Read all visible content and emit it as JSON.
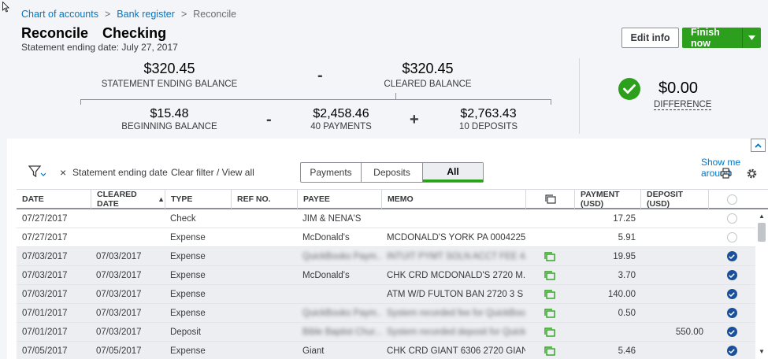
{
  "breadcrumb": {
    "item1": "Chart of accounts",
    "item2": "Bank register",
    "current": "Reconcile",
    "sep": ">"
  },
  "header": {
    "title": "Reconcile",
    "account": "Checking",
    "subtitle": "Statement ending date: July 27, 2017"
  },
  "buttons": {
    "edit_info": "Edit info",
    "finish_now": "Finish now"
  },
  "summary": {
    "statement_ending_balance": "$320.45",
    "statement_ending_balance_label": "STATEMENT ENDING BALANCE",
    "cleared_balance": "$320.45",
    "cleared_balance_label": "CLEARED BALANCE",
    "beginning_balance": "$15.48",
    "beginning_balance_label": "BEGINNING BALANCE",
    "payments_total": "$2,458.46",
    "payments_label": "40 PAYMENTS",
    "deposits_total": "$2,763.43",
    "deposits_label": "10 DEPOSITS",
    "difference": "$0.00",
    "difference_label": "DIFFERENCE",
    "op_minus": "-",
    "op_plus": "+"
  },
  "filter": {
    "close": "×",
    "statement_filter": "Statement ending date",
    "clear_filter": "Clear filter / View all"
  },
  "tabs": [
    {
      "label": "Payments"
    },
    {
      "label": "Deposits"
    },
    {
      "label": "All"
    }
  ],
  "links": {
    "show_me_around": "Show me around"
  },
  "table": {
    "columns": {
      "date": "DATE",
      "cleared_date": "CLEARED DATE",
      "sort_arrow": "▲",
      "type": "TYPE",
      "ref_no": "REF NO.",
      "payee": "PAYEE",
      "memo": "MEMO",
      "payment": "PAYMENT (USD)",
      "deposit": "DEPOSIT (USD)"
    },
    "rows": [
      {
        "date": "07/27/2017",
        "cleared": "",
        "type": "Check",
        "ref": "",
        "payee": "JIM & NENA'S",
        "memo": "",
        "payment": "17.25",
        "deposit": "",
        "status": "open"
      },
      {
        "date": "07/27/2017",
        "cleared": "",
        "type": "Expense",
        "ref": "",
        "payee": "McDonald's",
        "memo": "MCDONALD'S YORK PA 0004225...",
        "payment": "5.91",
        "deposit": "",
        "status": "open"
      },
      {
        "date": "07/03/2017",
        "cleared": "07/03/2017",
        "type": "Expense",
        "ref": "",
        "payee": "QuickBooks Paym...",
        "memo": "INTUIT PYMT SOLN ACCT FEE 4/...",
        "payment": "19.95",
        "deposit": "",
        "status": "cleared",
        "blur_payee": true,
        "blur_memo": true
      },
      {
        "date": "07/03/2017",
        "cleared": "07/03/2017",
        "type": "Expense",
        "ref": "",
        "payee": "McDonald's",
        "memo": "CHK CRD MCDONALD'S 2720 M...",
        "payment": "3.70",
        "deposit": "",
        "status": "cleared"
      },
      {
        "date": "07/03/2017",
        "cleared": "07/03/2017",
        "type": "Expense",
        "ref": "",
        "payee": "",
        "memo": "ATM W/D FULTON BAN 2720 3 S ...",
        "payment": "140.00",
        "deposit": "",
        "status": "cleared"
      },
      {
        "date": "07/01/2017",
        "cleared": "07/03/2017",
        "type": "Expense",
        "ref": "",
        "payee": "QuickBooks Paym...",
        "memo": "System recorded fee for QuickBoo...",
        "payment": "0.50",
        "deposit": "",
        "status": "cleared",
        "blur_payee": true,
        "blur_memo": true
      },
      {
        "date": "07/01/2017",
        "cleared": "07/03/2017",
        "type": "Deposit",
        "ref": "",
        "payee": "Bible Baptist Chur...",
        "memo": "System recorded deposit for QuickB...",
        "payment": "",
        "deposit": "550.00",
        "status": "cleared",
        "blur_payee": true,
        "blur_memo": true
      },
      {
        "date": "07/05/2017",
        "cleared": "07/05/2017",
        "type": "Expense",
        "ref": "",
        "payee": "Giant",
        "memo": "CHK CRD GIANT 6306 2720 GIAN...",
        "payment": "5.46",
        "deposit": "",
        "status": "cleared"
      }
    ]
  },
  "colors": {
    "accent_green": "#2ca01c",
    "link_blue": "#0077c5",
    "check_blue": "#1a4f9c"
  }
}
